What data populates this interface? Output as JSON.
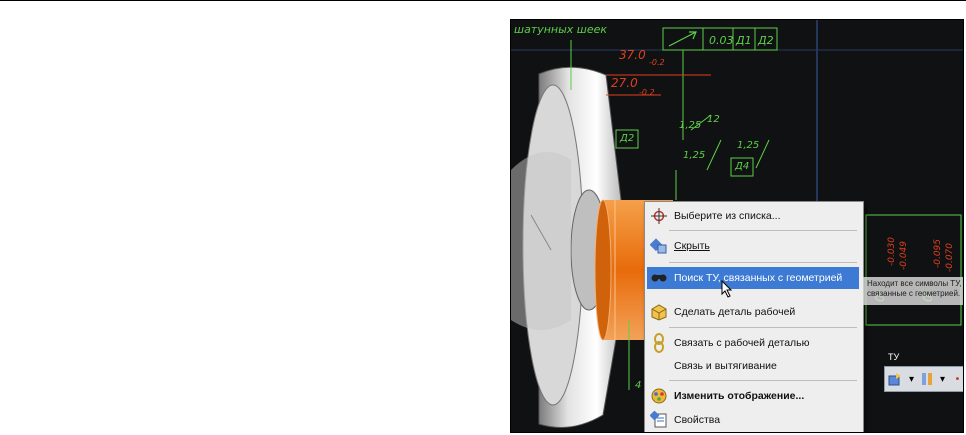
{
  "drawing": {
    "header_text": "шатунных шеек",
    "tolerance_value": "0.03",
    "datum_1": "Д1",
    "datum_2": "Д2",
    "dim_370": "37.0",
    "dim_370_tol": "-0.2",
    "dim_270": "27.0",
    "dim_270_tol": "-0.2",
    "roughness_1": "1,25",
    "roughness_1_len": "12",
    "roughness_2": "1,25",
    "roughness_3": "1,25",
    "datum_box_1": "Д2",
    "datum_box_2": "Д4",
    "dim_vertical_1": "0",
    "dim_vertical_1_tol_a": "-0.030",
    "dim_vertical_1_tol_b": "-0.049",
    "dim_vertical_2": "0",
    "dim_vertical_2_tol_a": "-0.095",
    "dim_vertical_2_tol_b": "-0.070",
    "small_label": "4"
  },
  "context_menu": {
    "items": [
      {
        "label": "Выберите из списка...",
        "icon": "crosshair-icon"
      },
      {
        "label": "Скрыть",
        "icon": "hide-icon"
      },
      {
        "label": "Поиск ТУ, связанных с геометрией",
        "icon": "find-pmi-icon"
      },
      {
        "label": "Сделать деталь рабочей",
        "icon": "work-part-icon"
      },
      {
        "label": "Связать с рабочей деталью",
        "icon": "link-icon"
      },
      {
        "label": "Связь и вытягивание",
        "icon": ""
      },
      {
        "label": "Изменить отображение...",
        "icon": "display-icon"
      },
      {
        "label": "Свойства",
        "icon": "properties-icon"
      }
    ]
  },
  "tooltip": {
    "text": "Находит все символы ТУ, связанные с геометрией."
  },
  "toolbar": {
    "title": "ТУ"
  },
  "colors": {
    "background": "#101112",
    "green_annotation": "#5ecf4a",
    "red_dimension": "#e0401f",
    "highlight": "#3d7ad4",
    "orange_part": "#f07e1a"
  }
}
